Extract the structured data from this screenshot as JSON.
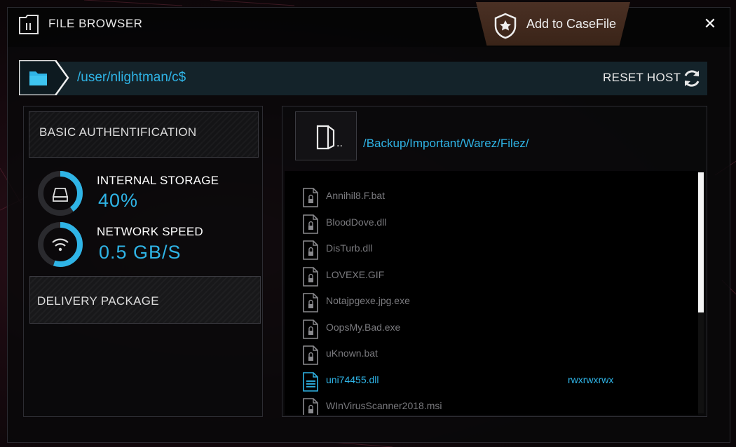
{
  "titlebar": {
    "title": "FILE BROWSER",
    "casefile_label": "Add to CaseFile",
    "close_label": "✕"
  },
  "pathbar": {
    "path": "/user/nlightman/c$",
    "reset_label": "RESET HOST"
  },
  "left": {
    "basic_auth_label": "BASIC AUTHENTIFICATION",
    "storage": {
      "title": "INTERNAL STORAGE",
      "value": "40%",
      "fraction": 0.4
    },
    "network": {
      "title": "NETWORK SPEED",
      "value": "0.5 GB/S",
      "fraction": 0.55
    },
    "delivery_label": "DELIVERY PACKAGE"
  },
  "right": {
    "up_label": "..",
    "sub_path": "/Backup/Important/Warez/Filez/",
    "files": [
      {
        "name": "Annihil8.F.bat",
        "perm": "",
        "locked": true
      },
      {
        "name": "BloodDove.dll",
        "perm": "",
        "locked": true
      },
      {
        "name": "DisTurb.dll",
        "perm": "",
        "locked": true
      },
      {
        "name": "LOVEXE.GIF",
        "perm": "",
        "locked": true
      },
      {
        "name": "Notajpgexe.jpg.exe",
        "perm": "",
        "locked": true
      },
      {
        "name": "OopsMy.Bad.exe",
        "perm": "",
        "locked": true
      },
      {
        "name": "uKnown.bat",
        "perm": "",
        "locked": true
      },
      {
        "name": "uni74455.dll",
        "perm": "rwxrwxrwx",
        "locked": false
      },
      {
        "name": "WInVirusScanner2018.msi",
        "perm": "",
        "locked": true
      }
    ],
    "scroll_fraction": 0.58
  },
  "colors": {
    "accent": "#2fb4e6",
    "tab": "#4a3024"
  }
}
